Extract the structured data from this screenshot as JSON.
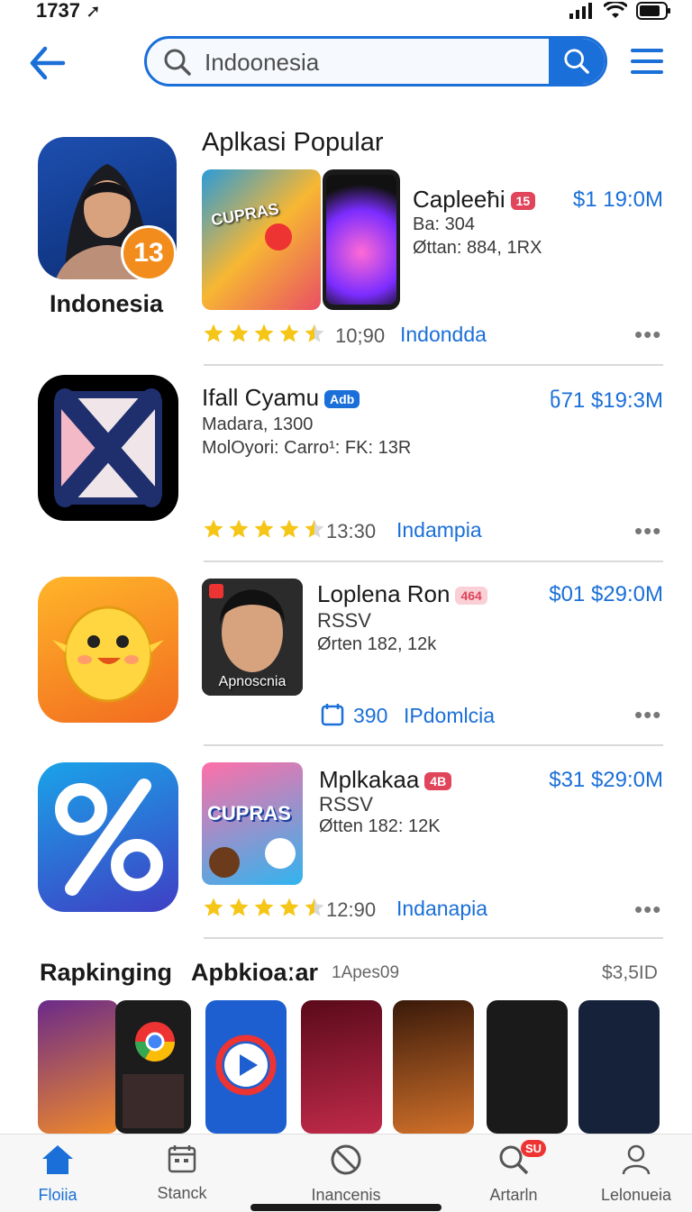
{
  "status": {
    "time": "1737"
  },
  "search": {
    "value": "Indoonesia"
  },
  "featured": {
    "badge": "13",
    "name": "Indonesia"
  },
  "section_title": "Aplkasi Popular",
  "apps": [
    {
      "title": "Capleeћi",
      "badge": "15",
      "badge_color": "#e0455c",
      "line1": "Ba: 304",
      "line2": "Øttan: 884, 1RX",
      "price": "$1 19:0M",
      "rating": 4.5,
      "rating_text": "10;90",
      "location": "Indondda",
      "more": "•••"
    },
    {
      "title": "Ifall Cyamu",
      "badge": "Adb",
      "badge_color": "#1a6fd8",
      "line1": "Madara, 1300",
      "line2": "MolOyori: Carro¹: FK: 13R",
      "price": "ნ71 $19:3M",
      "rating": 4.5,
      "rating_text": "13:30",
      "location": "Indampia",
      "more": "•••"
    },
    {
      "title": "Loplena Ron",
      "badge": "464",
      "badge_color": "#e0455c",
      "line1": "RSSV",
      "line2": "Ørten 182, 12k",
      "price": "$01 $29:0M",
      "thumb_label": "Apnoscnia",
      "rating_text": "390",
      "location": "IPdomlcia",
      "more": "•••"
    },
    {
      "title": "Mplkakaa",
      "badge": "4B",
      "badge_color": "#e0455c",
      "line1": "RSSV",
      "line2": "Øtten 182: 12K",
      "price": "$31 $29:0M",
      "thumb_label": "CUPRAS",
      "rating": 4.5,
      "rating_text": "12:90",
      "location": "Indanapia",
      "more": "•••"
    }
  ],
  "ranking": {
    "title_a": "Rapkinging",
    "title_b": "Apbkioaːar",
    "tag": "1Apes09",
    "price": "$3,5ID"
  },
  "tabs": [
    {
      "label": "Floiia",
      "icon": "home-icon",
      "active": true
    },
    {
      "label": "Stanck",
      "icon": "calendar-icon",
      "active": false
    },
    {
      "label": "Inancenis",
      "icon": "blocked-icon",
      "active": false
    },
    {
      "label": "Artarln",
      "icon": "search-icon",
      "badge": "SU",
      "active": false
    },
    {
      "label": "Lelonueia",
      "icon": "person-icon",
      "active": false
    }
  ],
  "colors": {
    "accent": "#1a6fd8",
    "star": "#f5c518",
    "badge_red": "#e0455c"
  }
}
